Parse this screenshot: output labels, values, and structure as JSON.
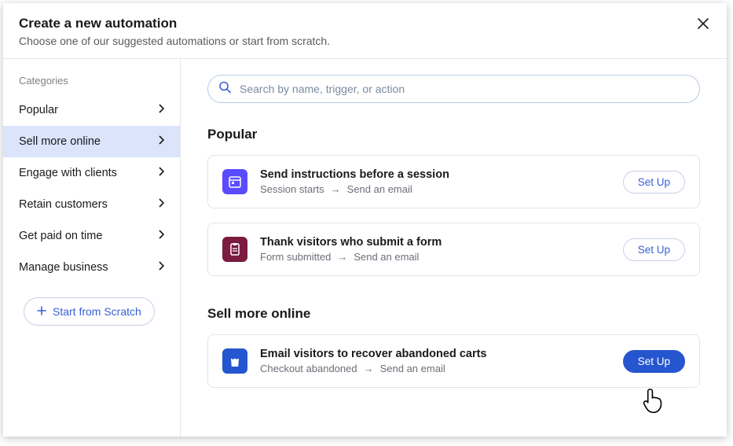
{
  "header": {
    "title": "Create a new automation",
    "subtitle": "Choose one of our suggested automations or start from scratch."
  },
  "sidebar": {
    "heading": "Categories",
    "items": [
      {
        "label": "Popular",
        "active": false
      },
      {
        "label": "Sell more online",
        "active": true
      },
      {
        "label": "Engage with clients",
        "active": false
      },
      {
        "label": "Retain customers",
        "active": false
      },
      {
        "label": "Get paid on time",
        "active": false
      },
      {
        "label": "Manage business",
        "active": false
      }
    ],
    "scratch_label": "Start from Scratch"
  },
  "search": {
    "placeholder": "Search by name, trigger, or action"
  },
  "sections": [
    {
      "title": "Popular",
      "cards": [
        {
          "icon": "calendar-icon",
          "icon_class": "icon-calendar",
          "title": "Send instructions before a session",
          "trigger": "Session starts",
          "action": "Send an email",
          "setup_label": "Set Up",
          "primary": false
        },
        {
          "icon": "clipboard-icon",
          "icon_class": "icon-form",
          "title": "Thank visitors who submit a form",
          "trigger": "Form submitted",
          "action": "Send an email",
          "setup_label": "Set Up",
          "primary": false
        }
      ]
    },
    {
      "title": "Sell more online",
      "cards": [
        {
          "icon": "shopping-bag-icon",
          "icon_class": "icon-bag",
          "title": "Email visitors to recover abandoned carts",
          "trigger": "Checkout abandoned",
          "action": "Send an email",
          "setup_label": "Set Up",
          "primary": true
        }
      ]
    }
  ]
}
